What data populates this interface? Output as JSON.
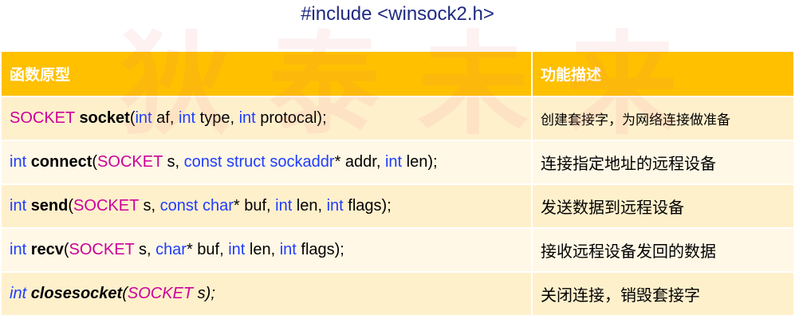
{
  "header": {
    "title": "#include <winsock2.h>"
  },
  "watermark": {
    "chars": [
      "狄",
      "泰",
      "未",
      "来"
    ]
  },
  "table": {
    "columns": [
      "函数原型",
      "功能描述"
    ],
    "rows": [
      {
        "sig": {
          "ret": "SOCKET",
          "fn": "socket",
          "open": "(",
          "t1": "int",
          "p1": " af, ",
          "t2": "int",
          "p2": " type, ",
          "t3": "int",
          "p3": " protocal);"
        },
        "desc": "创建套接字，为网络连接做准备"
      },
      {
        "sig": {
          "ret": "int",
          "fn": "connect",
          "open": "(",
          "t1": "SOCKET",
          "p1": " s, ",
          "t2": "const struct sockaddr",
          "p2": "* addr, ",
          "t3": "int",
          "p3": " len);"
        },
        "desc": "连接指定地址的远程设备"
      },
      {
        "sig": {
          "ret": "int",
          "fn": "send",
          "open": "(",
          "t1": "SOCKET",
          "p1": " s, ",
          "t2": "const char",
          "p2": "* buf, ",
          "t3": "int",
          "p3": " len, ",
          "t4": "int",
          "p4": " flags);"
        },
        "desc": "发送数据到远程设备"
      },
      {
        "sig": {
          "ret": "int",
          "fn": "recv",
          "open": "(",
          "t1": "SOCKET",
          "p1": " s, ",
          "t2": "char",
          "p2": "* buf, ",
          "t3": "int",
          "p3": " len, ",
          "t4": "int",
          "p4": " flags);"
        },
        "desc": "接收远程设备发回的数据"
      },
      {
        "sig": {
          "ret": "int",
          "fn": "closesocket",
          "open": "(",
          "t1": "SOCKET",
          "p1": "  s);"
        },
        "desc": "关闭连接，销毁套接字"
      }
    ]
  },
  "colors": {
    "header_bg": "#ffc000",
    "row_light": "#fff0cc",
    "row_lighter": "#fff8e6",
    "keyword": "#1e3cff",
    "type": "#cc0099",
    "title": "#1f2a80"
  }
}
